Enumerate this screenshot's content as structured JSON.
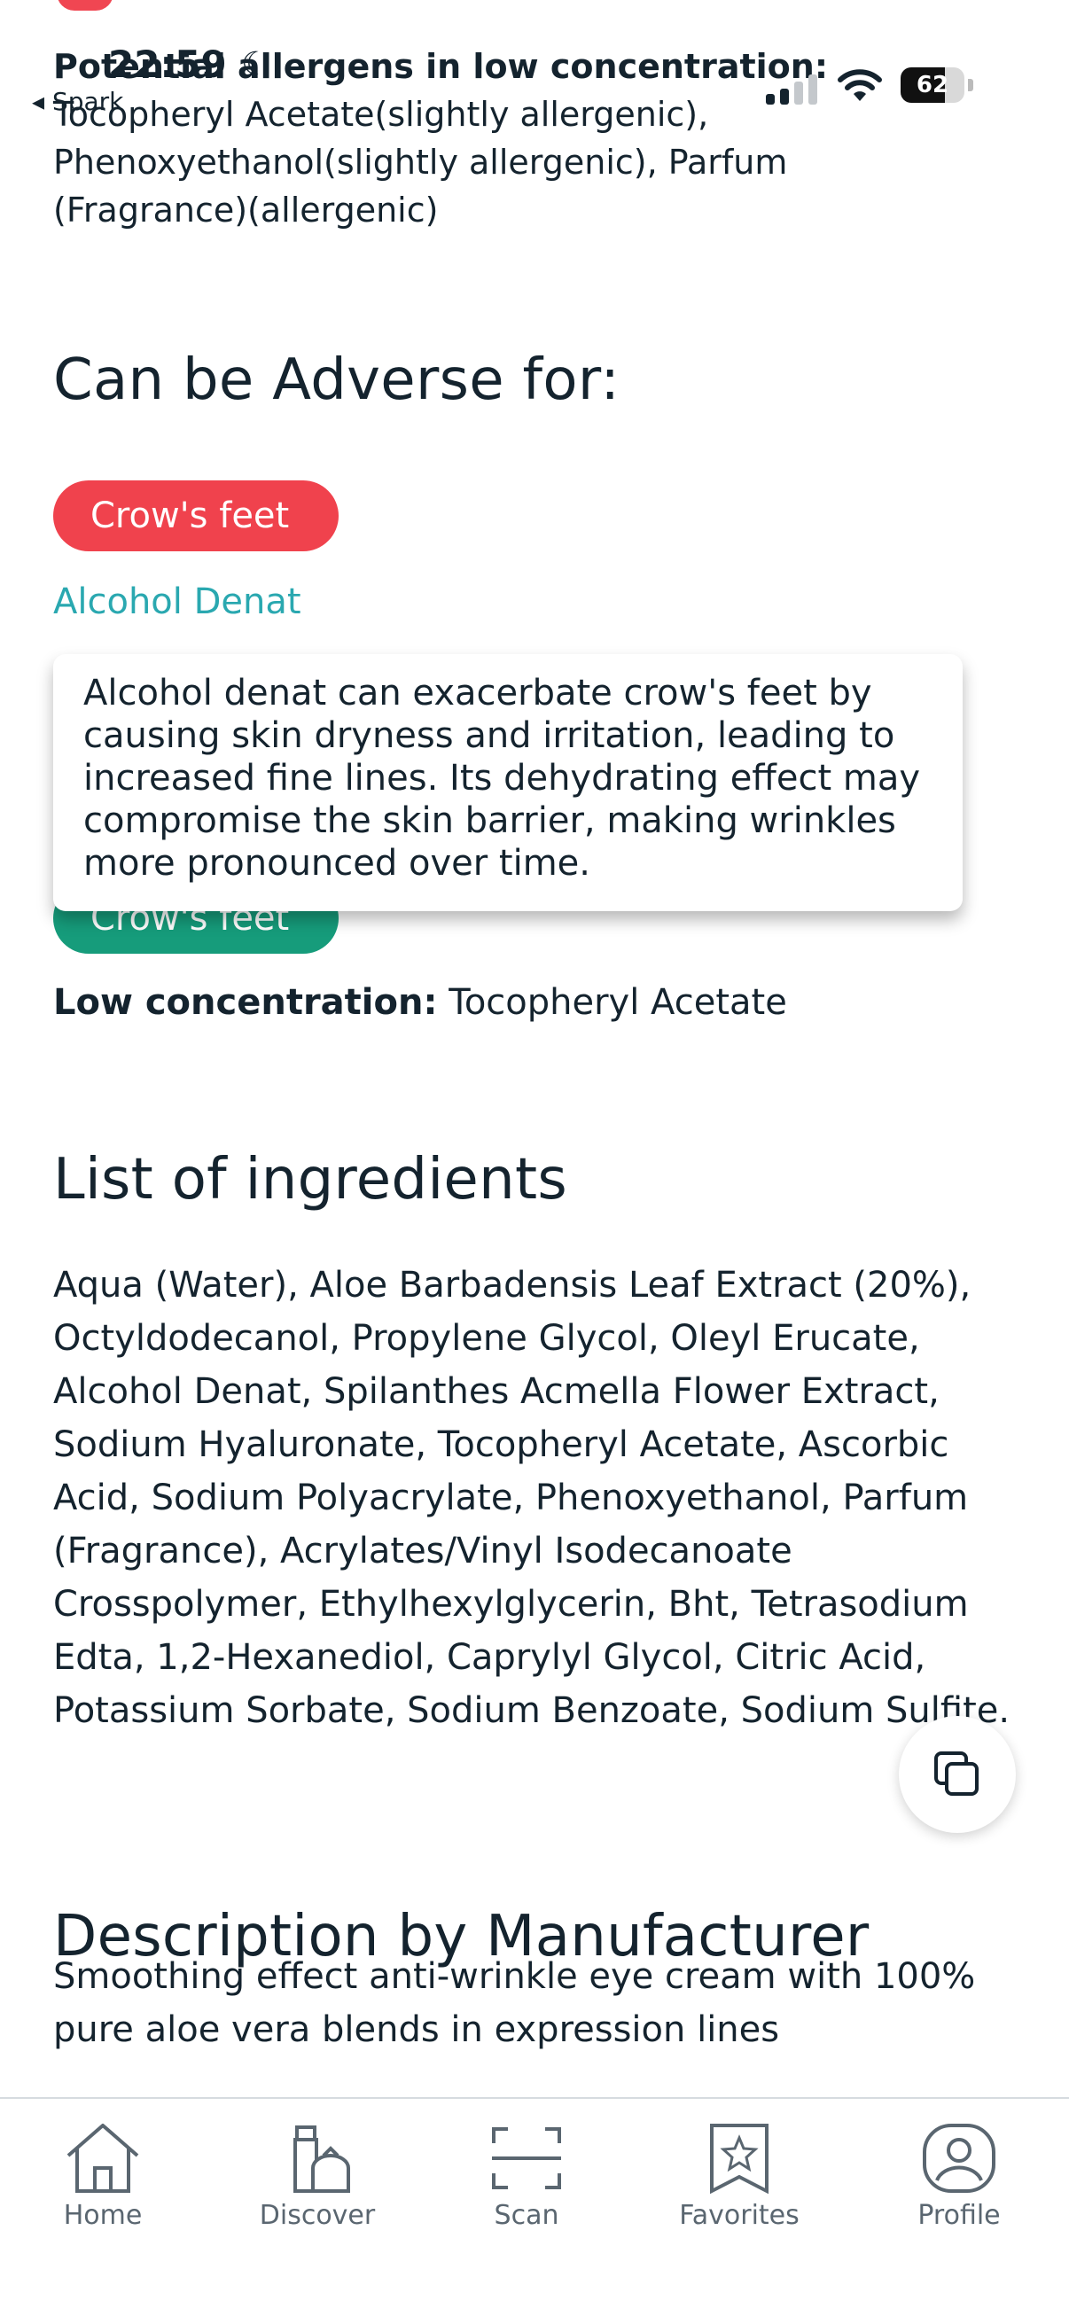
{
  "status_bar": {
    "time": "22:59",
    "back_app": "◂ Spark",
    "battery": "62"
  },
  "allergens": {
    "heading": "Potential allergens in low concentration:",
    "text": "Tocopheryl Acetate(slightly allergenic), Phenoxyethanol(slightly allergenic), Parfum (Fragrance)(allergenic)"
  },
  "adverse": {
    "heading": "Can be Adverse for:",
    "chip_label": "Crow's feet",
    "ingredient": "Alcohol Denat",
    "tooltip": "Alcohol denat can exacerbate crow's feet by causing skin dryness and irritation, leading to increased fine lines. Its dehydrating effect may compromise the skin barrier, making wrinkles more pronounced over time."
  },
  "beneficial": {
    "chip_label": "Crow's feet",
    "low_concentration_label": "Low concentration:",
    "low_concentration_value": "Tocopheryl Acetate"
  },
  "ingredients": {
    "heading": "List of ingredients",
    "text": "Aqua (Water), Aloe Barbadensis Leaf Extract (20%), Octyldodecanol, Propylene Glycol, Oleyl Erucate, Alcohol Denat, Spilanthes Acmella Flower Extract, Sodium Hyaluronate, Tocopheryl Acetate, Ascorbic Acid, Sodium Polyacrylate, Phenoxyethanol, Parfum (Fragrance), Acrylates/Vinyl Isodecanoate Crosspolymer, Ethylhexylglycerin, Bht, Tetrasodium Edta, 1,2-Hexanediol, Caprylyl Glycol, Citric Acid, Potassium Sorbate, Sodium Benzoate, Sodium Sulfite."
  },
  "manufacturer": {
    "heading": "Description by Manufacturer",
    "text": "Smoothing effect anti-wrinkle eye cream with 100% pure aloe vera blends in expression lines"
  },
  "tabs": [
    {
      "label": "Home",
      "icon": "home-icon"
    },
    {
      "label": "Discover",
      "icon": "discover-icon"
    },
    {
      "label": "Scan",
      "icon": "scan-icon"
    },
    {
      "label": "Favorites",
      "icon": "favorites-icon"
    },
    {
      "label": "Profile",
      "icon": "profile-icon"
    }
  ],
  "colors": {
    "adverse_chip": "#f0424d",
    "beneficial_chip": "#169c7b",
    "link": "#2aa8b0",
    "text": "#14232e"
  }
}
